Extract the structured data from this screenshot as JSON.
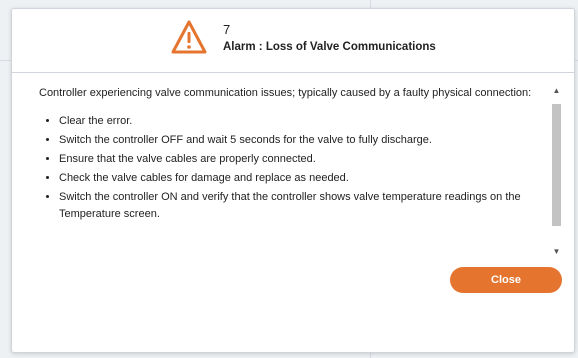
{
  "alarm": {
    "code": "7",
    "title": "Alarm : Loss of Valve Communications",
    "icon": "warning-triangle-icon",
    "icon_color": "#e5752e"
  },
  "message": {
    "intro": "Controller experiencing valve communication issues; typically caused by a faulty physical connection:",
    "steps": [
      "Clear the error.",
      "Switch the controller OFF and wait 5 seconds for the valve to fully discharge.",
      "Ensure that the valve cables are properly connected.",
      "Check the valve cables for damage and replace as needed.",
      "Switch the controller ON and verify that the controller shows valve temperature readings on the Temperature screen."
    ]
  },
  "footer": {
    "close_label": "Close",
    "close_color": "#e5752e"
  }
}
